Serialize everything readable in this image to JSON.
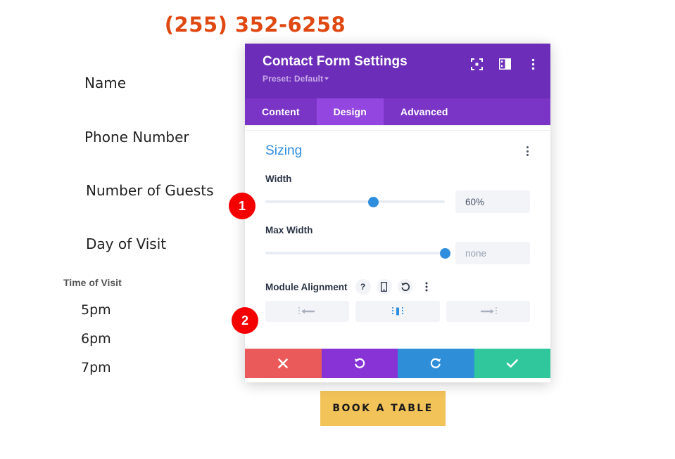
{
  "page": {
    "phone_number": "(255) 352-6258",
    "form_labels": [
      "Name",
      "Phone Number",
      "Number of Guests",
      "Day of Visit"
    ],
    "time_heading": "Time of Visit",
    "time_options": [
      "5pm",
      "6pm",
      "7pm"
    ],
    "book_button_label": "BOOK A TABLE",
    "accent_phone_color": "#e04812",
    "book_button_color": "#f2c359"
  },
  "modal": {
    "title": "Contact Form Settings",
    "preset_label": "Preset: Default",
    "header_icons": [
      {
        "name": "focus-target-icon"
      },
      {
        "name": "layout-panel-icon"
      },
      {
        "name": "more-options-icon"
      }
    ],
    "tabs": [
      {
        "label": "Content",
        "active": false
      },
      {
        "label": "Design",
        "active": true
      },
      {
        "label": "Advanced",
        "active": false
      }
    ],
    "section": {
      "title": "Sizing",
      "fields": [
        {
          "label": "Width",
          "value": "60%",
          "is_placeholder": false,
          "slider_percent": 60
        },
        {
          "label": "Max Width",
          "value": "none",
          "is_placeholder": true,
          "slider_percent": 100
        }
      ],
      "alignment": {
        "label": "Module Alignment",
        "controls": [
          {
            "name": "help-icon",
            "glyph": "?"
          },
          {
            "name": "responsive-mobile-icon",
            "glyph": ""
          },
          {
            "name": "reset-icon",
            "glyph": ""
          },
          {
            "name": "more-options-icon",
            "glyph": ""
          }
        ],
        "options": [
          {
            "name": "align-left",
            "active": false
          },
          {
            "name": "align-center",
            "active": true
          },
          {
            "name": "align-right",
            "active": false
          }
        ]
      }
    },
    "footer_buttons": [
      {
        "name": "cancel-button",
        "icon": "close-icon",
        "color": "#ea5a5a"
      },
      {
        "name": "undo-button",
        "icon": "undo-icon",
        "color": "#8733d6"
      },
      {
        "name": "redo-button",
        "icon": "redo-icon",
        "color": "#2e8ed8"
      },
      {
        "name": "save-button",
        "icon": "check-icon",
        "color": "#2fc79b"
      }
    ],
    "header_color": "#6c2eb9",
    "tabbar_color": "#7b35c6",
    "active_tab_color": "#9346e0"
  },
  "callouts": [
    {
      "number": "1",
      "target": "width-field"
    },
    {
      "number": "2",
      "target": "module-alignment-field"
    }
  ]
}
